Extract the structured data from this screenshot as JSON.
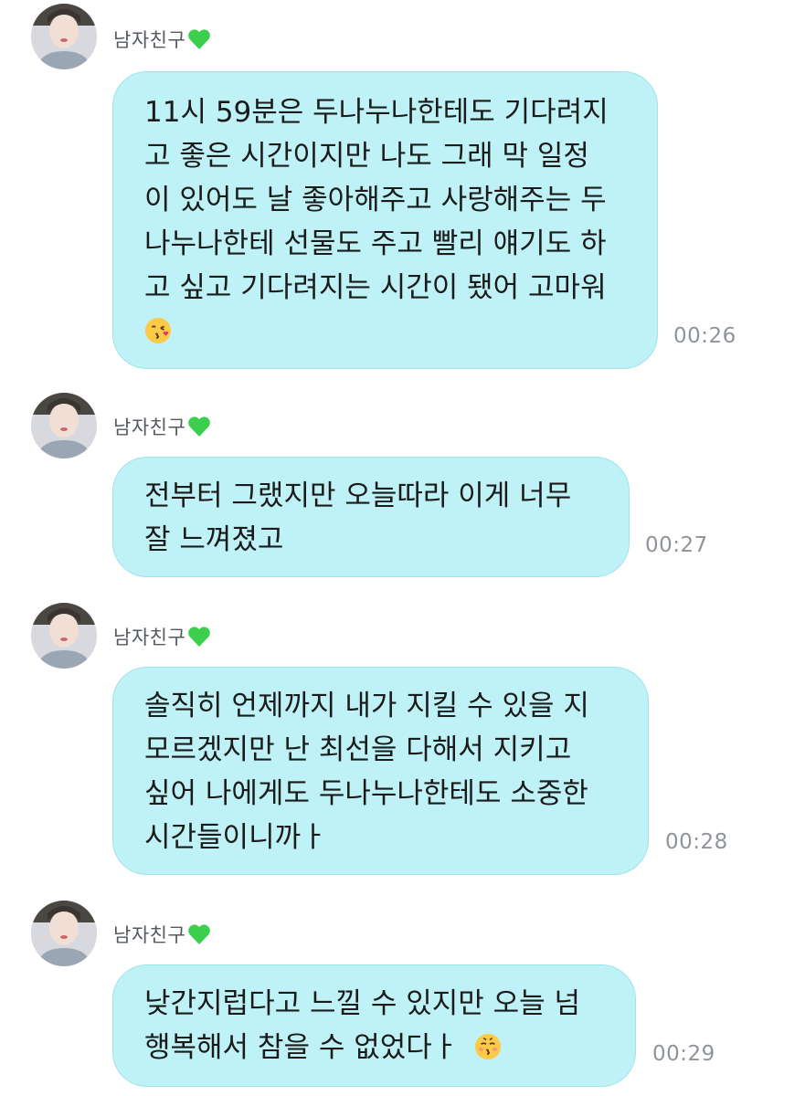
{
  "sender_name": "남자친구",
  "icons": {
    "sender_heart": "green-heart-icon",
    "kiss_emoji": "face-blowing-kiss-emoji",
    "kissing_emoji": "kissing-face-closed-eyes-emoji"
  },
  "colors": {
    "bubble": "#bff2f6",
    "heart": "#3ccf4e"
  },
  "messages": [
    {
      "lines": [
        "11시 59분은 두나누나한테도 기다려지",
        "고 좋은 시간이지만 나도 그래 막 일정",
        "이 있어도 날 좋아해주고 사랑해주는 두",
        "나누나한테 선물도 주고 빨리 얘기도 하",
        "고 싶고 기다려지는 시간이 됐어 고마워"
      ],
      "emoji": "face-blowing-kiss-emoji",
      "time": "00:26"
    },
    {
      "lines": [
        "전부터 그랬지만 오늘따라 이게 너무",
        "잘 느껴졌고"
      ],
      "time": "00:27"
    },
    {
      "lines": [
        "솔직히 언제까지 내가 지킬 수 있을 지",
        "모르겠지만 난 최선을 다해서 지키고",
        "싶어 나에게도 두나누나한테도 소중한",
        "시간들이니까ㅏ"
      ],
      "time": "00:28"
    },
    {
      "lines": [
        "낮간지럽다고 느낄 수 있지만 오늘 넘",
        "행복해서 참을 수 없었다ㅏ "
      ],
      "emoji": "kissing-face-closed-eyes-emoji",
      "time": "00:29"
    }
  ]
}
